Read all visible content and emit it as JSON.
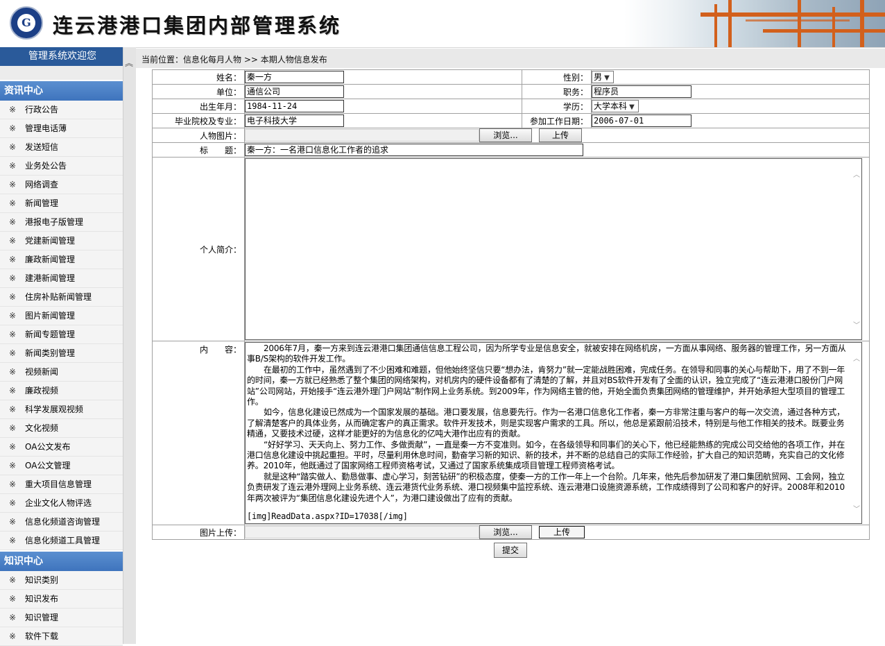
{
  "header": {
    "app_title": "连云港港口集团内部管理系统",
    "logo_char": "G"
  },
  "sidebar": {
    "welcome": "管理系统欢迎您",
    "sections": [
      {
        "title": "资讯中心",
        "items": [
          "行政公告",
          "管理电话薄",
          "发送短信",
          "业务处公告",
          "网络调查",
          "新闻管理",
          "港报电子版管理",
          "党建新闻管理",
          "廉政新闻管理",
          "建港新闻管理",
          "住房补贴新闻管理",
          "图片新闻管理",
          "新闻专题管理",
          "新闻类别管理",
          "视频新闻",
          "廉政视频",
          "科学发展观视频",
          "文化视频",
          "OA公文发布",
          "OA公文管理",
          "重大项目信息管理",
          "企业文化人物评选",
          "信息化频道咨询管理",
          "信息化频道工具管理"
        ]
      },
      {
        "title": "知识中心",
        "items": [
          "知识类别",
          "知识发布",
          "知识管理",
          "软件下载"
        ]
      }
    ],
    "item_mark": "※"
  },
  "breadcrumb": "当前位置：信息化每月人物 >> 本期人物信息发布",
  "form": {
    "name_label": "姓名：",
    "name_value": "秦一方",
    "gender_label": "性别：",
    "gender_value": "男",
    "unit_label": "单位：",
    "unit_value": "通信公司",
    "position_label": "职务：",
    "position_value": "程序员",
    "birth_label": "出生年月：",
    "birth_value": "1984-11-24",
    "education_label": "学历：",
    "education_value": "大学本科",
    "school_label": "毕业院校及专业：",
    "school_value": "电子科技大学",
    "workdate_label": "参加工作日期：",
    "workdate_value": "2006-07-01",
    "photo_label": "人物图片：",
    "browse_label": "浏览...",
    "upload_label": "上传",
    "title_label": "标　　题：",
    "title_value": "秦一方：一名港口信息化工作者的追求",
    "intro_label": "个人简介：",
    "content_label": "内　　容：",
    "content_paragraphs": [
      "2006年7月，秦一方来到连云港港口集团通信信息工程公司，因为所学专业是信息安全，就被安排在网络机房，一方面从事网络、服务器的管理工作，另一方面从事B/S架构的软件开发工作。",
      "在最初的工作中，虽然遇到了不少困难和难题，但他始终坚信只要“想办法，肯努力”就一定能战胜困难，完成任务。在领导和同事的关心与帮助下，用了不到一年的时间，秦一方就已经熟悉了整个集团的网络架构，对机房内的硬件设备都有了清楚的了解，并且对BS软件开发有了全面的认识，独立完成了“连云港港口股份门户网站”公司网站，开始接手“连云港外理门户网站”制作网上业务系统。到2009年，作为网络主管的他，开始全面负责集团网络的管理维护，并开始承担大型项目的管理工作。",
      "如今，信息化建设已然成为一个国家发展的基础。港口要发展，信息要先行。作为一名港口信息化工作者，秦一方非常注重与客户的每一次交流，通过各种方式，了解清楚客户的具体业务，从而确定客户的真正需求。软件开发技术，则是实现客户需求的工具。所以，他总是紧跟前沿技术，特别是与他工作相关的技术。既要业务精通，又要技术过硬，这样才能更好的为信息化的亿吨大港作出应有的贡献。",
      "“好好学习、天天向上、努力工作、多做贡献”，一直是秦一方不变准则。如今，在各级领导和同事们的关心下，他已经能熟练的完成公司交给他的各项工作，并在港口信息化建设中挑起重担。平时，尽量利用休息时间，勤奋学习新的知识、新的技术，并不断的总结自己的实际工作经验，扩大自己的知识范畴，充实自己的文化修养。2010年，他既通过了国家网络工程师资格考试，又通过了国家系统集成项目管理工程师资格考试。",
      "就是这种“踏实做人、勤恳做事、虚心学习，刻苦钻研”的积极态度，使秦一方的工作一年上一个台阶。几年来，他先后参加研发了港口集团航贸网、工会网，独立负责研发了连云港外理网上业务系统、连云港货代业务系统、港口视频集中监控系统、连云港港口设施资源系统，工作成绩得到了公司和客户的好评。2008年和2010年两次被评为“集团信息化建设先进个人”，为港口建设做出了应有的贡献。"
    ],
    "content_img_tag": "[img]ReadData.aspx?ID=17038[/img]",
    "image_upload_label": "图片上传：",
    "submit_label": "提交"
  }
}
